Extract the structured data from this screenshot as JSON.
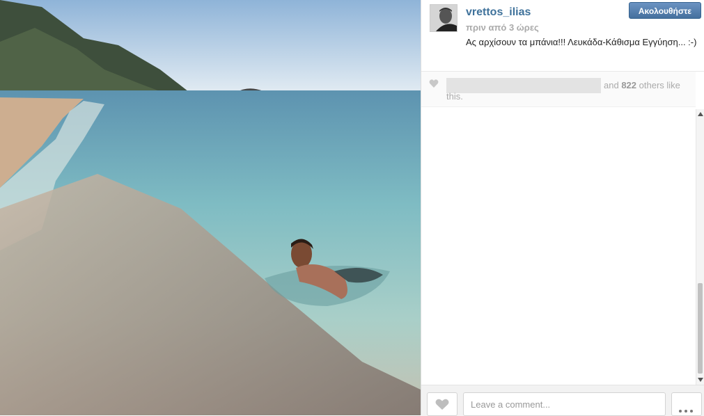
{
  "post": {
    "username": "vrettos_ilias",
    "timestamp": "πριν από 3 ώρες",
    "caption": "Ας αρχίσουν τα μπάνια!!! Λευκάδα-Κάθισμα Εγγύηση... :-)",
    "follow_label": "Ακολουθήστε"
  },
  "likes": {
    "connector": "and",
    "count": "822",
    "suffix": "others like this."
  },
  "comment_box": {
    "placeholder": "Leave a comment..."
  },
  "icons": {
    "heart": "heart-icon",
    "more": "ellipsis-icon"
  },
  "colors": {
    "username": "#3f729b",
    "follow_button": "#5079a7",
    "muted_text": "#aaaaaa"
  }
}
